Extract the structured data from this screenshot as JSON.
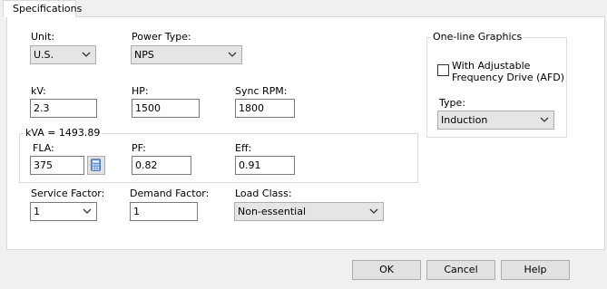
{
  "tab": {
    "label": "Specifications"
  },
  "unit": {
    "label": "Unit:",
    "value": "U.S."
  },
  "power_type": {
    "label": "Power Type:",
    "value": "NPS"
  },
  "kv": {
    "label": "kV:",
    "value": "2.3"
  },
  "hp": {
    "label": "HP:",
    "value": "1500"
  },
  "sync_rpm": {
    "label": "Sync RPM:",
    "value": "1800"
  },
  "kva_group": {
    "title": "kVA = 1493.89"
  },
  "fla": {
    "label": "FLA:",
    "value": "375"
  },
  "pf": {
    "label": "PF:",
    "value": "0.82"
  },
  "eff": {
    "label": "Eff:",
    "value": "0.91"
  },
  "service_factor": {
    "label": "Service Factor:",
    "value": "1"
  },
  "demand_factor": {
    "label": "Demand Factor:",
    "value": "1"
  },
  "load_class": {
    "label": "Load Class:",
    "value": "Non-essential"
  },
  "one_line": {
    "title": "One-line Graphics",
    "afd_label_line1": "With Adjustable",
    "afd_label_line2": "Frequency Drive (AFD)",
    "afd_checked": false,
    "type_label": "Type:",
    "type_value": "Induction"
  },
  "buttons": {
    "ok": "OK",
    "cancel": "Cancel",
    "help": "Help"
  },
  "icons": {
    "dropdown": "chevron-down-icon",
    "calculator": "calculator-icon"
  }
}
